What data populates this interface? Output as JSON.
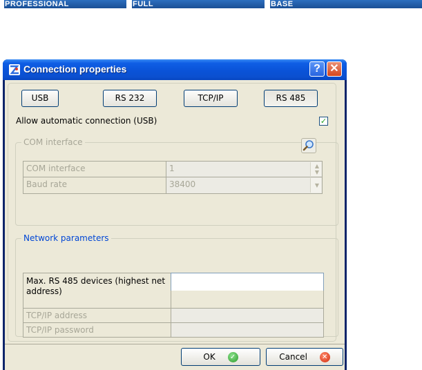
{
  "editions": [
    "PROFESSIONAL",
    "FULL",
    "BASE"
  ],
  "window": {
    "title": "Connection properties",
    "help_label": "?",
    "close_label": "✕"
  },
  "tabs": [
    {
      "label": "USB"
    },
    {
      "label": "RS 232"
    },
    {
      "label": "TCP/IP"
    },
    {
      "label": "RS 485",
      "active": true
    }
  ],
  "auto_connect": {
    "label": "Allow automatic connection (USB)",
    "checked": true,
    "check_glyph": "✓"
  },
  "com_interface": {
    "legend": "COM interface",
    "search_icon": "search-icon",
    "rows": [
      {
        "label": "COM interface",
        "value": "1"
      },
      {
        "label": "Baud rate",
        "value": "38400"
      }
    ]
  },
  "network": {
    "legend": "Network parameters",
    "rows": [
      {
        "label": "Max. RS 485 devices (highest net address)",
        "value": ""
      },
      {
        "label": "TCP/IP address",
        "value": ""
      },
      {
        "label": "TCP/IP password",
        "value": ""
      }
    ]
  },
  "footer": {
    "ok_label": "OK",
    "cancel_label": "Cancel"
  },
  "colors": {
    "titlebar": "#0a53d8",
    "dialog_bg": "#ece9d8",
    "edition_bar": "#1f5aa6",
    "network_legend": "#0046d5",
    "disabled_text": "#a7a697"
  }
}
